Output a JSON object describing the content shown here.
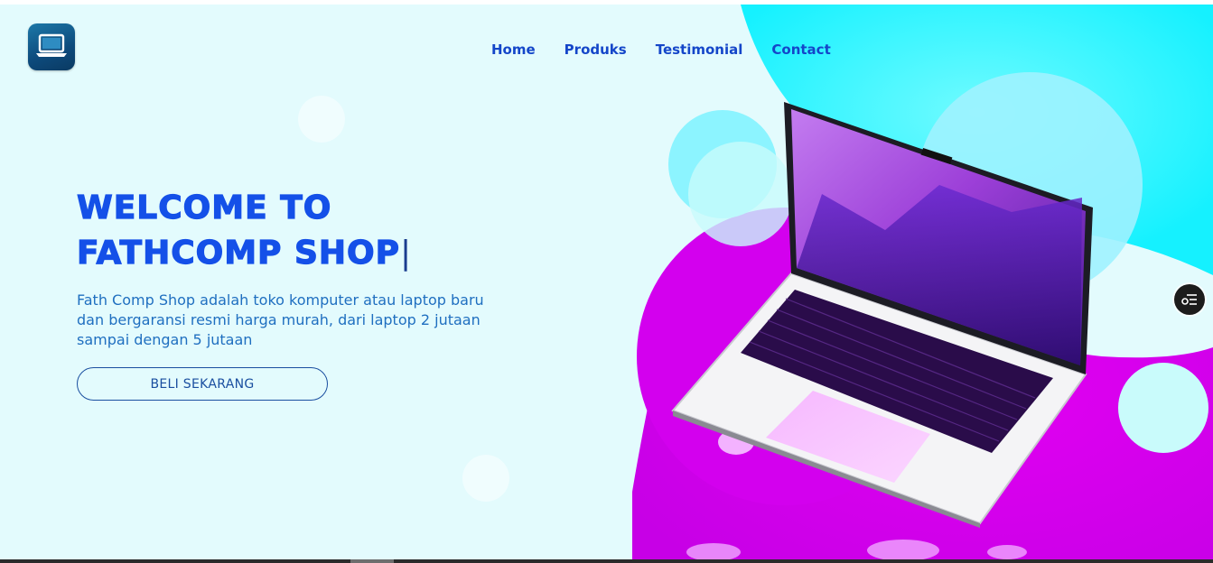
{
  "nav": {
    "items": [
      {
        "label": "Home"
      },
      {
        "label": "Produks"
      },
      {
        "label": "Testimonial"
      },
      {
        "label": "Contact"
      }
    ]
  },
  "hero": {
    "title_line1": "WELCOME TO",
    "title_line2": "FATHCOMP SHOP",
    "caret": "|",
    "description": "Fath Comp Shop adalah toko komputer atau laptop baru dan bergaransi resmi harga murah, dari laptop 2 jutaan sampai dengan 5 jutaan",
    "cta_label": "BELI SEKARANG"
  },
  "icons": {
    "logo": "laptop-logo-icon",
    "floating": "settings-toggle-icon",
    "hero_image": "laptop-illustration"
  },
  "colors": {
    "page_background": "#e3fbfd",
    "heading": "#1450e8",
    "nav_link": "#1446c9",
    "body_text": "#1f6fc0",
    "bubble_cyan": "#27f6ff",
    "bubble_magenta": "#e000f0"
  }
}
